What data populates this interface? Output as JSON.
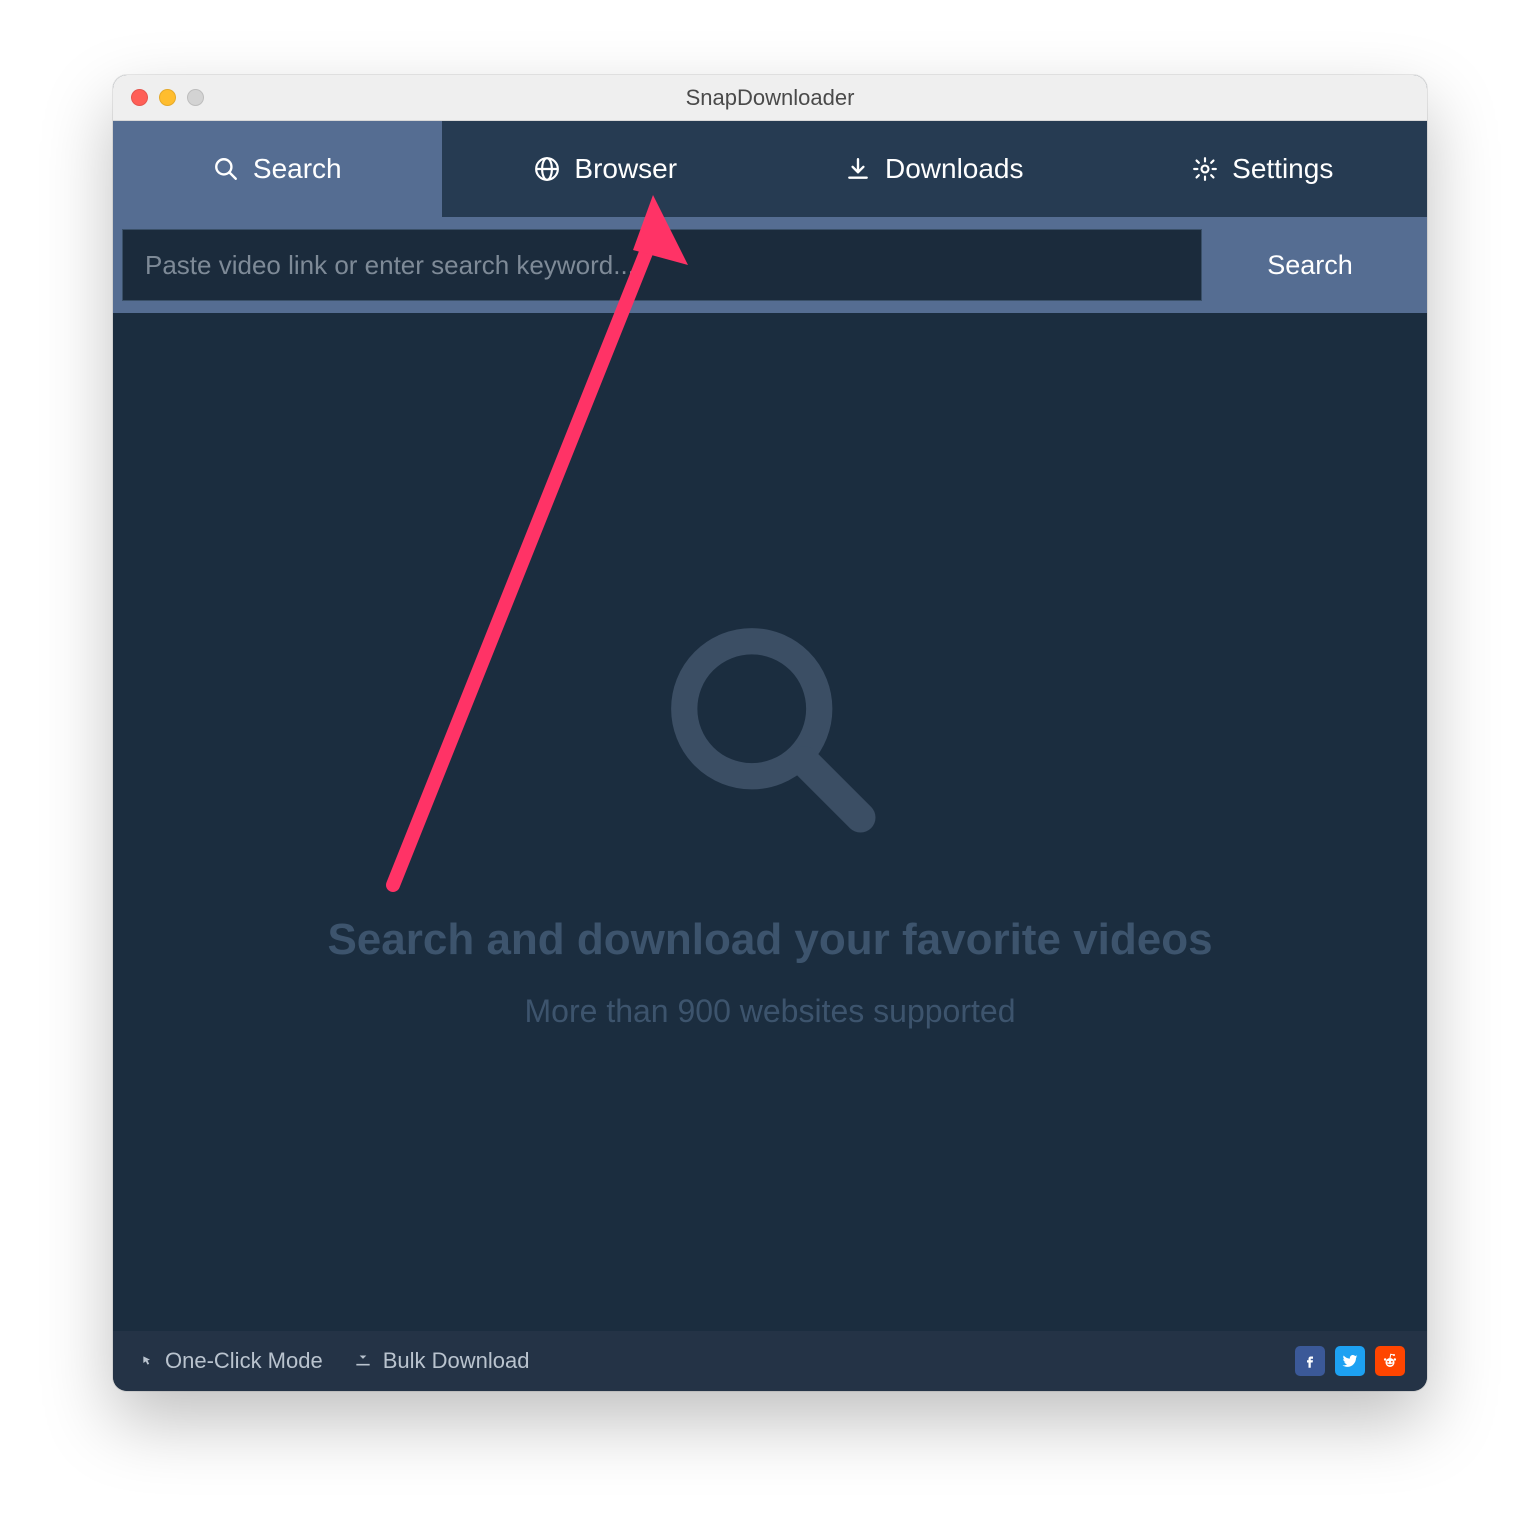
{
  "window": {
    "title": "SnapDownloader"
  },
  "tabs": {
    "search": "Search",
    "browser": "Browser",
    "downloads": "Downloads",
    "settings": "Settings"
  },
  "searchbar": {
    "placeholder": "Paste video link or enter search keyword...",
    "button": "Search"
  },
  "empty_state": {
    "headline": "Search and download your favorite videos",
    "subline": "More than 900 websites supported"
  },
  "footer": {
    "one_click": "One-Click Mode",
    "bulk": "Bulk Download"
  }
}
